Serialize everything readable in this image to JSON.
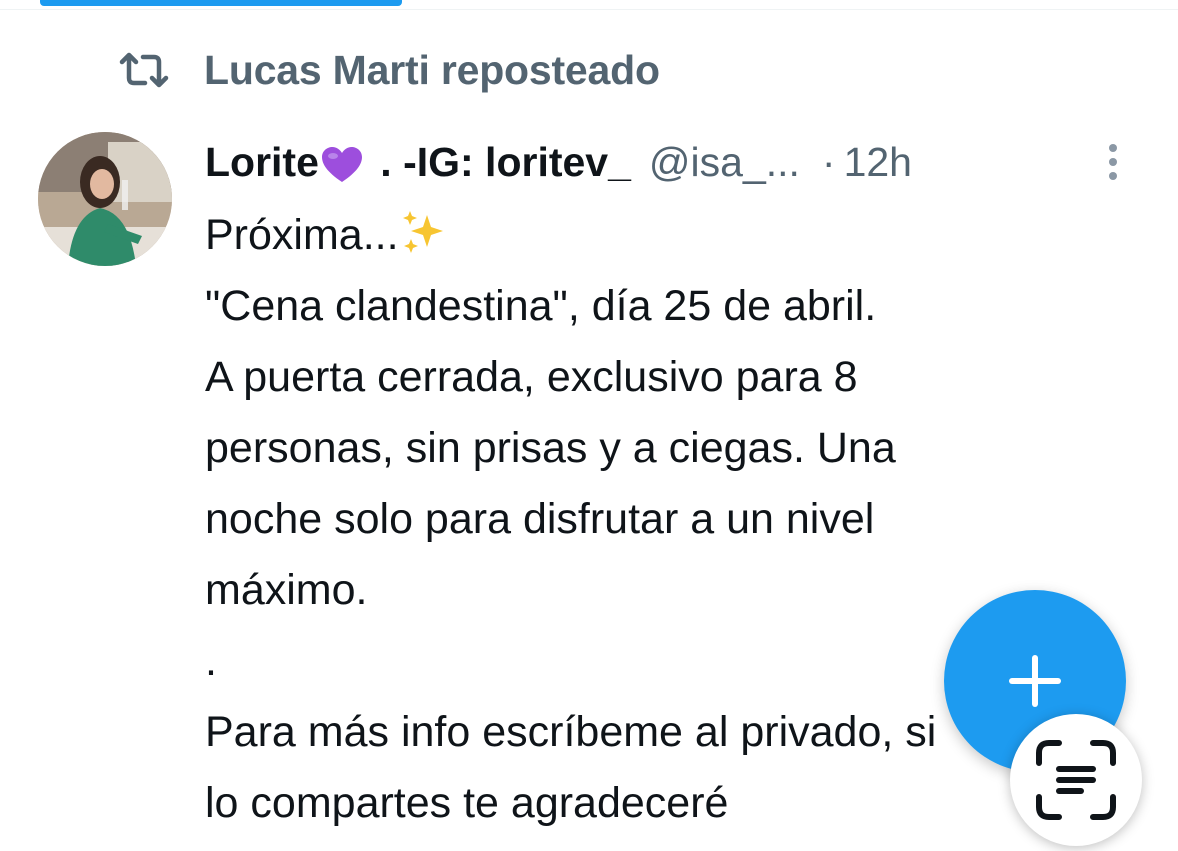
{
  "repost": {
    "icon": "repost-icon",
    "text": "Lucas Marti reposteado"
  },
  "tweet": {
    "avatar_icon": "avatar",
    "display_name_before_emoji": "Lorite",
    "display_name_after_emoji": " . -IG: loritev_",
    "emoji": "purple-heart-icon",
    "handle": "@isa_...",
    "separator": "·",
    "time": "12h",
    "more_icon": "more-vertical-icon",
    "lines": [
      "Próxima...",
      " \"Cena clandestina\", día 25 de abril.",
      "A puerta cerrada, exclusivo para 8",
      "personas, sin prisas y a ciegas. Una",
      "noche solo para disfrutar a un nivel",
      "máximo.",
      ".",
      "Para más info escríbeme al privado, si",
      "lo compartes te agradeceré"
    ]
  },
  "fab": {
    "icon": "plus-icon",
    "color": "#1d9bf0"
  },
  "scan_button": {
    "icon": "text-scan-icon"
  },
  "colors": {
    "accent": "#1d9bf0",
    "secondary_text": "#536471",
    "primary_text": "#0f1419"
  }
}
